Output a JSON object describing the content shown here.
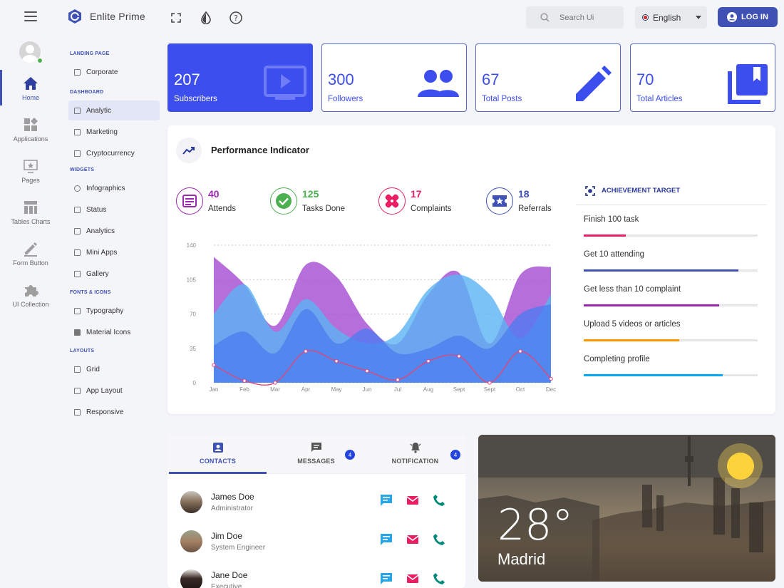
{
  "header": {
    "brand": "Enlite Prime",
    "search_placeholder": "Search Ui",
    "language": "English",
    "login_label": "LOG IN"
  },
  "rail": {
    "items": [
      {
        "label": "Home",
        "icon": "home-icon"
      },
      {
        "label": "Applications",
        "icon": "widgets-icon"
      },
      {
        "label": "Pages",
        "icon": "pages-icon"
      },
      {
        "label": "Tables Charts",
        "icon": "table-icon"
      },
      {
        "label": "Form Button",
        "icon": "edit-icon"
      },
      {
        "label": "UI Collection",
        "icon": "puzzle-icon"
      }
    ]
  },
  "submenu": {
    "groups": [
      {
        "heading": "LANDING PAGE",
        "items": [
          "Corporate"
        ]
      },
      {
        "heading": "DASHBOARD",
        "items": [
          "Analytic",
          "Marketing",
          "Cryptocurrency"
        ]
      },
      {
        "heading": "WIDGETS",
        "items": [
          "Infographics",
          "Status",
          "Analytics",
          "Mini Apps",
          "Gallery"
        ]
      },
      {
        "heading": "FONTS & ICONS",
        "items": [
          "Typography",
          "Material Icons"
        ]
      },
      {
        "heading": "LAYOUTS",
        "items": [
          "Grid",
          "App Layout",
          "Responsive"
        ]
      }
    ]
  },
  "stats": [
    {
      "value": "207",
      "label": "Subscribers",
      "icon": "play-screen-icon"
    },
    {
      "value": "300",
      "label": "Followers",
      "icon": "people-icon"
    },
    {
      "value": "67",
      "label": "Total Posts",
      "icon": "pencil-icon"
    },
    {
      "value": "70",
      "label": "Total Articles",
      "icon": "library-books-icon"
    }
  ],
  "performance": {
    "title": "Performance Indicator",
    "kpis": [
      {
        "value": "40",
        "label": "Attends",
        "color": "#9c27b0"
      },
      {
        "value": "125",
        "label": "Tasks Done",
        "color": "#4caf50"
      },
      {
        "value": "17",
        "label": "Complaints",
        "color": "#e91e63"
      },
      {
        "value": "18",
        "label": "Referrals",
        "color": "#3f51b5"
      }
    ],
    "achievement": {
      "title": "ACHIEVEMENT TARGET",
      "items": [
        {
          "label": "Finish 100 task",
          "progress": 0.24,
          "color": "#e91e63"
        },
        {
          "label": "Get 10 attending",
          "progress": 0.89,
          "color": "#3f51b5"
        },
        {
          "label": "Get less than 10 complaint",
          "progress": 0.78,
          "color": "#9c27b0"
        },
        {
          "label": "Upload 5 videos or articles",
          "progress": 0.55,
          "color": "#ff9800"
        },
        {
          "label": "Completing profile",
          "progress": 0.8,
          "color": "#03a9f4"
        }
      ]
    }
  },
  "chart_data": {
    "type": "area",
    "categories": [
      "Jan",
      "Feb",
      "Mar",
      "Apr",
      "May",
      "Jun",
      "Jul",
      "Aug",
      "Sept",
      "Sept",
      "Oct",
      "Dec"
    ],
    "ylim": [
      0,
      140
    ],
    "yticks": [
      0,
      35,
      70,
      105,
      140
    ],
    "series": [
      {
        "values": [
          128,
          100,
          58,
          120,
          108,
          60,
          40,
          90,
          112,
          40,
          110,
          118
        ],
        "color": "#a855d4"
      },
      {
        "values": [
          70,
          100,
          52,
          85,
          55,
          40,
          50,
          95,
          110,
          90,
          45,
          90
        ],
        "color": "#5ab4f4"
      },
      {
        "values": [
          38,
          52,
          30,
          75,
          40,
          55,
          30,
          35,
          48,
          35,
          70,
          80
        ],
        "color": "#4a7cf0"
      },
      {
        "values": [
          18,
          2,
          0,
          32,
          22,
          12,
          3,
          22,
          27,
          0,
          32,
          4
        ],
        "color": "#e0457b"
      }
    ]
  },
  "tabs": {
    "items": [
      {
        "label": "CONTACTS",
        "badge": ""
      },
      {
        "label": "MESSAGES",
        "badge": "4"
      },
      {
        "label": "NOTIFICATION",
        "badge": "4"
      }
    ],
    "contacts": [
      {
        "name": "James Doe",
        "role": "Administrator"
      },
      {
        "name": "Jim Doe",
        "role": "System Engineer"
      },
      {
        "name": "Jane Doe",
        "role": "Executive"
      }
    ]
  },
  "weather": {
    "temperature": "28°",
    "city": "Madrid"
  }
}
